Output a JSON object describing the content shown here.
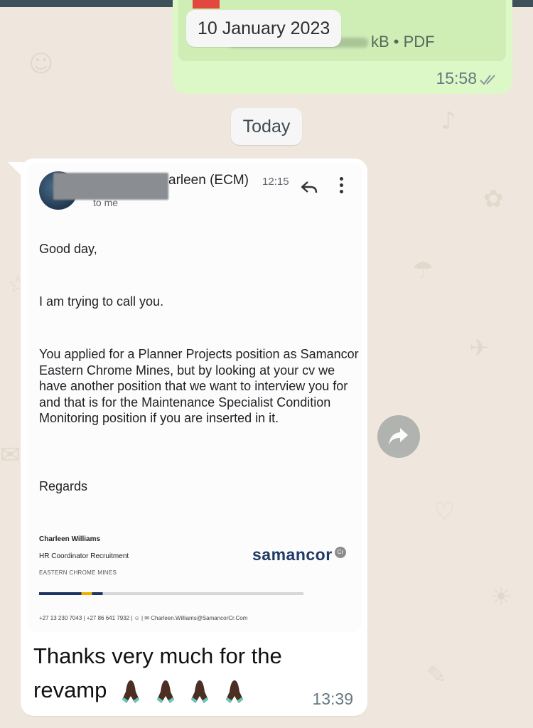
{
  "previous_message": {
    "document_meta_suffix": "kB • PDF",
    "time": "15:58",
    "date_chip": "10 January 2023"
  },
  "today_chip": "Today",
  "incoming_message": {
    "email_screenshot": {
      "sender_partial": "arleen (ECM)",
      "time": "12:15",
      "to_line": "to me",
      "greeting": "Good day,",
      "line2": "I am trying to call you.",
      "paragraph": "You applied for a Planner Projects position as Samancor Eastern Chrome Mines, but by looking at your cv we have another position that we want to interview you for and that is for the Maintenance Specialist Condition Monitoring position if you are inserted in it.",
      "regards": "Regards",
      "signature": {
        "name": "Charleen Williams",
        "title": "HR Coordinator Recruitment",
        "org": "EASTERN CHROME MINES",
        "logo": "samancor",
        "logo_badge": "Cr",
        "contact": "+27 13 230 7043 | +27 86 641 7932 | ☺ | ✉ Charleen.Williams@SamancorCr.Com"
      }
    },
    "caption": "Thanks very much for the revamp",
    "emoji": [
      "praying-hands-icon",
      "praying-hands-icon",
      "praying-hands-icon",
      "praying-hands-icon"
    ],
    "time": "13:39"
  },
  "icons": {
    "forward": "forward-arrow-icon",
    "reply": "reply-arrow-icon",
    "more": "more-vert-icon",
    "read_ticks": "double-check-icon"
  },
  "colors": {
    "chat_background": "#efe7de",
    "outgoing_bubble": "#dcf8c6",
    "incoming_bubble": "#ffffff",
    "brand_logo": "#1f3a68"
  }
}
